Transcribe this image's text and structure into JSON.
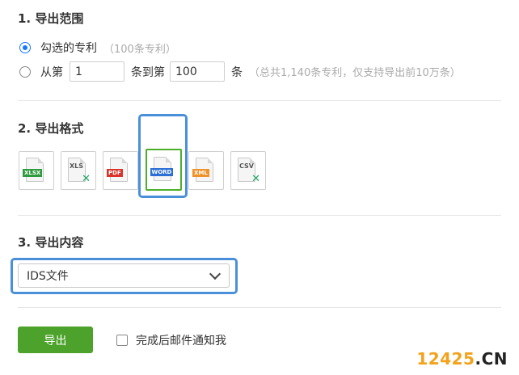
{
  "range_section": {
    "title": "1. 导出范围",
    "option_selected": {
      "label": "勾选的专利",
      "hint": "（100条专利）",
      "checked": true
    },
    "option_range": {
      "prefix": "从第",
      "start_value": "1",
      "middle": "条到第",
      "end_value": "100",
      "suffix": "条",
      "hint": "（总共1,140条专利，仅支持导出前10万条）",
      "checked": false
    }
  },
  "format_section": {
    "title": "2. 导出格式",
    "formats": [
      {
        "label": "XLSX",
        "icon": "xlsx-file-icon",
        "color": "#2e9b3e"
      },
      {
        "label": "XLS",
        "icon": "xls-file-icon",
        "color": "#21a366"
      },
      {
        "label": "PDF",
        "icon": "pdf-file-icon",
        "color": "#d9342b"
      },
      {
        "label": "WORD",
        "icon": "word-file-icon",
        "color": "#2b6fd6",
        "selected": true
      },
      {
        "label": "XML",
        "icon": "xml-file-icon",
        "color": "#f0922b"
      },
      {
        "label": "CSV",
        "icon": "csv-file-icon",
        "color": "#21a366"
      }
    ]
  },
  "content_section": {
    "title": "3. 导出内容",
    "selected_value": "IDS文件"
  },
  "actions": {
    "export_label": "导出",
    "notify_label": "完成后邮件通知我",
    "notify_checked": false
  },
  "watermark": {
    "part_a": "12425",
    "part_b": ".CN"
  },
  "colors": {
    "accent_blue": "#1677ff",
    "highlight_blue": "#4a90d9",
    "primary_green": "#4ca22a"
  }
}
